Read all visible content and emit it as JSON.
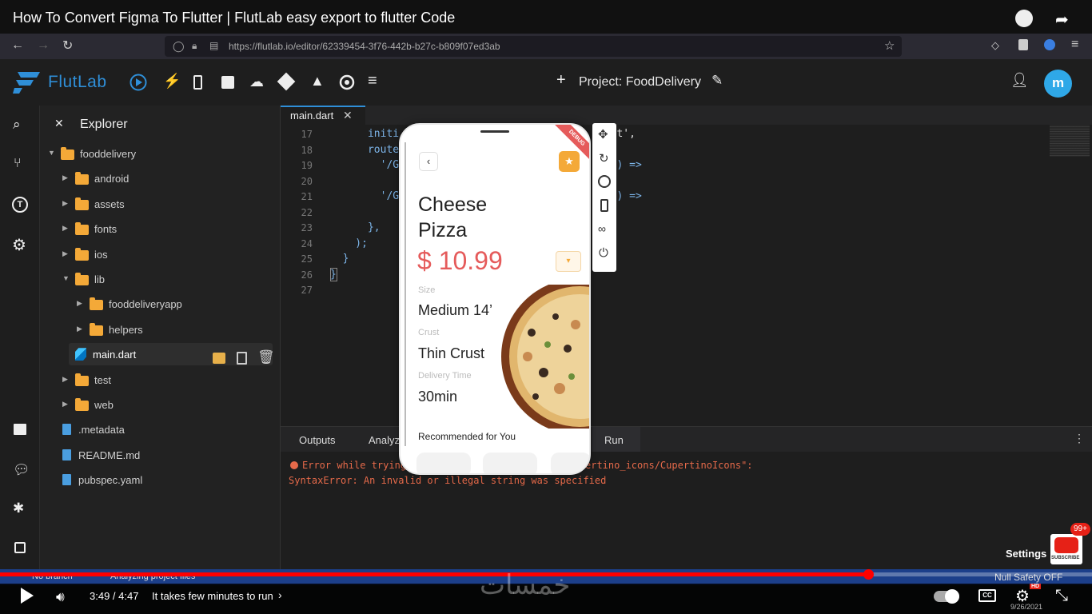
{
  "video": {
    "title": "How To Convert Figma To Flutter | FlutLab easy export to flutter Code",
    "time": "3:49 / 4:47",
    "chapter": "It takes few minutes to run",
    "settings": "Settings",
    "subscribe": "SUBSCRIBE",
    "badge": "99+",
    "date": "9/26/2021",
    "hd": "HD",
    "progress_fraction": 0.795,
    "watermark": "خمسات"
  },
  "browser": {
    "url": "https://flutlab.io/editor/62339454-3f76-442b-b27c-b809f07ed3ab"
  },
  "app": {
    "logo": "FlutLab",
    "project": "Project: FoodDelivery",
    "avatar_letter": "m",
    "accent": "#2f8fd8"
  },
  "explorer": {
    "title": "Explorer",
    "items": [
      {
        "label": "fooddelivery",
        "kind": "folder",
        "open": true,
        "depth": 0
      },
      {
        "label": "android",
        "kind": "folder",
        "depth": 1
      },
      {
        "label": "assets",
        "kind": "folder",
        "depth": 1
      },
      {
        "label": "fonts",
        "kind": "folder",
        "depth": 1
      },
      {
        "label": "ios",
        "kind": "folder",
        "depth": 1
      },
      {
        "label": "lib",
        "kind": "folder",
        "open": true,
        "depth": 1
      },
      {
        "label": "fooddeliveryapp",
        "kind": "folder",
        "depth": 2
      },
      {
        "label": "helpers",
        "kind": "folder",
        "depth": 2
      },
      {
        "label": "main.dart",
        "kind": "dart",
        "depth": 1,
        "selected": true
      },
      {
        "label": "test",
        "kind": "folder",
        "depth": 1
      },
      {
        "label": "web",
        "kind": "folder",
        "depth": 1
      },
      {
        "label": ".metadata",
        "kind": "file",
        "depth": 0
      },
      {
        "label": "README.md",
        "kind": "file",
        "depth": 0
      },
      {
        "label": "pubspec.yaml",
        "kind": "file",
        "depth": 0
      }
    ]
  },
  "editor": {
    "tab": "main.dart",
    "lines": [
      {
        "n": "17",
        "code": "      initi",
        "tail": "dget',"
      },
      {
        "n": "18",
        "code": "      route",
        "tail": ""
      },
      {
        "n": "19",
        "code": "        '/G",
        "tail": "ext) =>"
      },
      {
        "n": "20",
        "code": "",
        "tail": ""
      },
      {
        "n": "21",
        "code": "        '/G",
        "tail": "ext) =>"
      },
      {
        "n": "22",
        "code": "",
        "tail": ""
      },
      {
        "n": "23",
        "code": "      },",
        "tail": ""
      },
      {
        "n": "24",
        "code": "    );",
        "tail": ""
      },
      {
        "n": "25",
        "code": "  }",
        "tail": ""
      },
      {
        "n": "26",
        "code": "}",
        "tail": ""
      },
      {
        "n": "27",
        "code": "",
        "tail": ""
      }
    ]
  },
  "output": {
    "tabs": [
      "Outputs",
      "Analyz",
      "Run"
    ],
    "error_line1": "Error while trying",
    "error_line1_tail": "ertino_icons/CupertinoIcons\":",
    "error_line2": "SyntaxError: An invalid or illegal string was specified"
  },
  "phone": {
    "ribbon": "DEBUG",
    "title_l1": "Cheese",
    "title_l2": "Pizza",
    "price": "$ 10.99",
    "size_label": "Size",
    "size_value": "Medium 14’",
    "crust_label": "Crust",
    "crust_value": "Thin Crust",
    "delivery_label": "Delivery Time",
    "delivery_value": "30min",
    "recommended": "Recommended for You",
    "price_color": "#e55b5b",
    "accent_orange": "#f4a938"
  },
  "status": {
    "branch": "No branch",
    "analyzing": "Analyzing project files",
    "null_safety": "Null Safety OFF"
  }
}
